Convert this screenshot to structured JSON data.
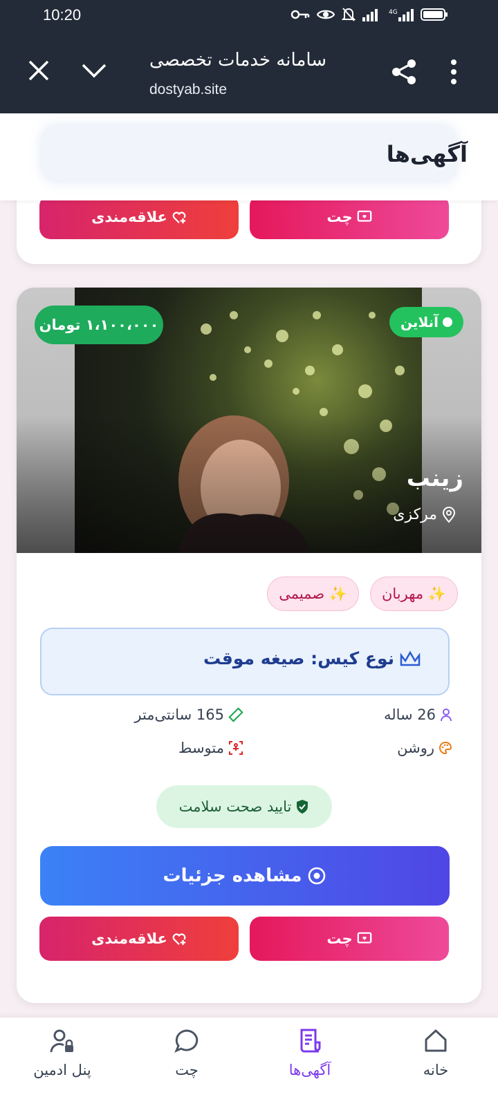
{
  "status_bar": {
    "time": "10:20"
  },
  "browser": {
    "title": "سامانه خدمات تخصصی",
    "url": "dostyab.site"
  },
  "header": {
    "title": "آگهی‌ها"
  },
  "prev_card": {
    "chat_label": "چت",
    "like_label": "علاقه‌مندی"
  },
  "listing": {
    "price": "۱،۱۰۰،۰۰۰ تومان",
    "status": "آنلاین",
    "name": "زینب",
    "location": "مرکزی",
    "tags": [
      "✨ مهربان",
      "✨ صمیمی"
    ],
    "case_type": "نوع کیس: صیغه موقت",
    "age": "26 ساله",
    "height": "165 سانتی‌متر",
    "skin": "روشن",
    "body": "متوسط",
    "health": "تایید صحت سلامت",
    "details_label": "مشاهده جزئیات",
    "chat_label": "چت",
    "like_label": "علاقه‌مندی"
  },
  "bottom_nav": [
    {
      "label": "خانه",
      "icon": "home-icon"
    },
    {
      "label": "آگهی‌ها",
      "icon": "ads-icon",
      "active": true
    },
    {
      "label": "چت",
      "icon": "chat-icon"
    },
    {
      "label": "پنل ادمین",
      "icon": "admin-icon"
    }
  ],
  "colors": {
    "accent": "#7c3aed",
    "chat": "#e5185b",
    "online": "#24c25e",
    "details": "#4f46e5"
  }
}
